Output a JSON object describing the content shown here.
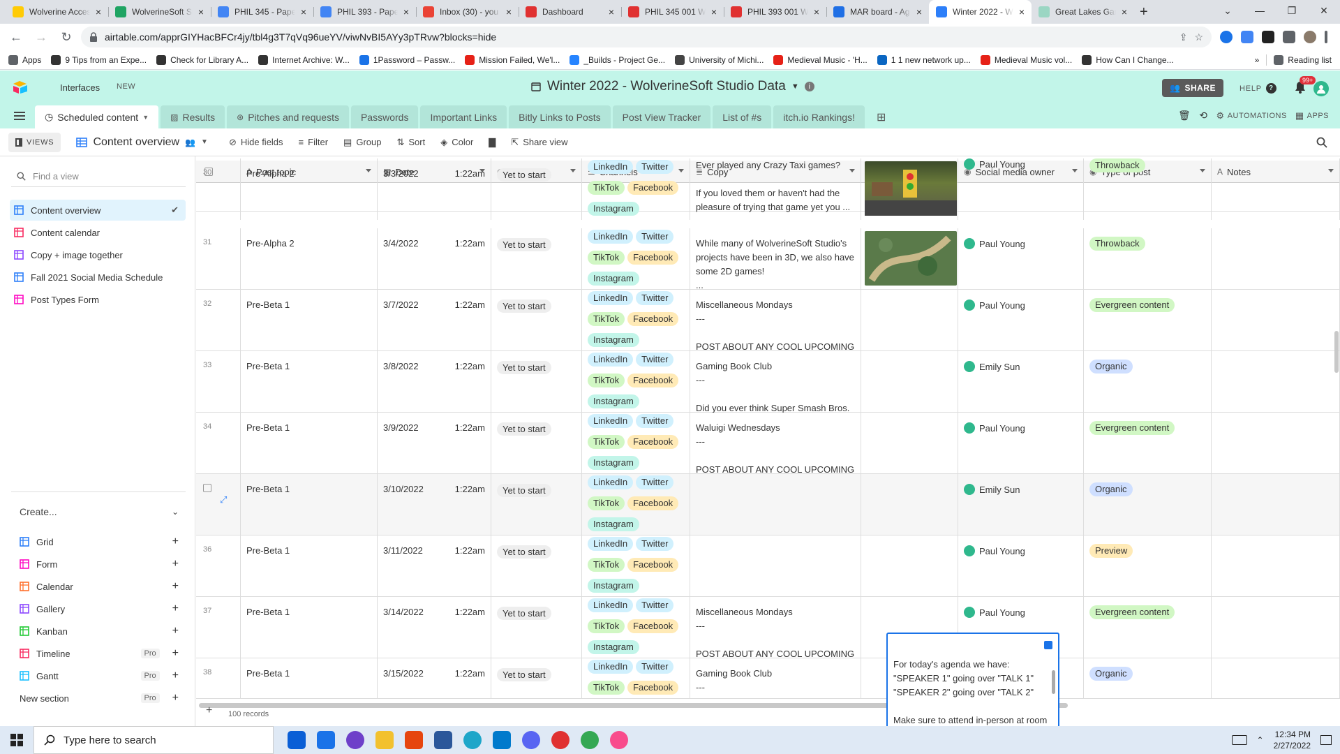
{
  "browser": {
    "tabs": [
      {
        "title": "Wolverine Accessibility",
        "color": "#ffcb05"
      },
      {
        "title": "WolverineSoft Studio",
        "color": "#1fa463"
      },
      {
        "title": "PHIL 345 - Paper",
        "color": "#4285f4"
      },
      {
        "title": "PHIL 393 - Paper",
        "color": "#4285f4"
      },
      {
        "title": "Inbox (30) - you",
        "color": "#ea4335"
      },
      {
        "title": "Dashboard",
        "color": "#e03131"
      },
      {
        "title": "PHIL 345 001 W",
        "color": "#e03131"
      },
      {
        "title": "PHIL 393 001 W",
        "color": "#e03131"
      },
      {
        "title": "MAR board - Ag",
        "color": "#1f6fe5"
      },
      {
        "title": "Winter 2022 - W",
        "color": "#2d7ff9"
      },
      {
        "title": "Great Lakes Gar",
        "color": "#9bd6c3"
      }
    ],
    "active_tab_index": 9,
    "new_tab": "+",
    "url": "airtable.com/apprGIYHacBFCr4jy/tbl4g3T7qVq96ueYV/viwNvBI5AYy3pTRvw?blocks=hide",
    "bookmarks": [
      {
        "label": "Apps",
        "color": "#5f6368"
      },
      {
        "label": "9 Tips from an Expe...",
        "color": "#333"
      },
      {
        "label": "Check for Library A...",
        "color": "#333"
      },
      {
        "label": "Internet Archive: W...",
        "color": "#333"
      },
      {
        "label": "1Password – Passw...",
        "color": "#1a73e8"
      },
      {
        "label": "Mission Failed, We'l...",
        "color": "#e62117"
      },
      {
        "label": "_Builds - Project Ge...",
        "color": "#2684ff"
      },
      {
        "label": "University of Michi...",
        "color": "#444"
      },
      {
        "label": "Medieval Music - 'H...",
        "color": "#e62117"
      },
      {
        "label": "1 1 new network up...",
        "color": "#0a66c2"
      },
      {
        "label": "Medieval Music vol...",
        "color": "#e62117"
      },
      {
        "label": "How Can I Change...",
        "color": "#333"
      }
    ],
    "bookmarks_more": "»",
    "reading_list": "Reading list"
  },
  "airtable": {
    "interfaces_label": "Interfaces",
    "new_badge": "NEW",
    "base_title": "Winter 2022 - WolverineSoft Studio Data",
    "share_label": "SHARE",
    "help_label": "HELP",
    "notif_count": "99+",
    "table_tabs": [
      "Scheduled content",
      "Results",
      "Pitches and requests",
      "Passwords",
      "Important Links",
      "Bitly Links to Posts",
      "Post View Tracker",
      "List of #s",
      "itch.io Rankings!"
    ],
    "automations_label": "AUTOMATIONS",
    "apps_label": "APPS",
    "views_label": "VIEWS",
    "current_view": "Content overview",
    "toolbar": {
      "hide_fields": "Hide fields",
      "filter": "Filter",
      "group": "Group",
      "sort": "Sort",
      "color": "Color",
      "share_view": "Share view"
    }
  },
  "sidebar": {
    "find_placeholder": "Find a view",
    "views": [
      {
        "label": "Content overview",
        "icon": "grid-icon",
        "color": "#2d7ff9"
      },
      {
        "label": "Content calendar",
        "icon": "calendar-icon",
        "color": "#f82b60"
      },
      {
        "label": "Copy + image together",
        "icon": "gallery-icon",
        "color": "#8b46ff"
      },
      {
        "label": "Fall 2021 Social Media Schedule",
        "icon": "grid-icon",
        "color": "#2d7ff9"
      },
      {
        "label": "Post Types Form",
        "icon": "form-icon",
        "color": "#ff08c2"
      }
    ],
    "create_label": "Create...",
    "create_items": [
      {
        "label": "Grid",
        "color": "#2d7ff9",
        "pro": ""
      },
      {
        "label": "Form",
        "color": "#ff08c2",
        "pro": ""
      },
      {
        "label": "Calendar",
        "color": "#ff6f2c",
        "pro": ""
      },
      {
        "label": "Gallery",
        "color": "#8b46ff",
        "pro": ""
      },
      {
        "label": "Kanban",
        "color": "#20c933",
        "pro": ""
      },
      {
        "label": "Timeline",
        "color": "#f82b60",
        "pro": "Pro"
      },
      {
        "label": "Gantt",
        "color": "#18bfff",
        "pro": "Pro"
      }
    ],
    "new_section": "New section",
    "new_section_pro": "Pro"
  },
  "grid": {
    "headers": [
      "Post topic",
      "Date",
      "Status",
      "Channels",
      "Copy",
      "Image",
      "Social media owner",
      "Type of post",
      "Notes"
    ],
    "rows": [
      {
        "num": "30",
        "topic": "Pre-Alpha 2",
        "date": "3/3/2022",
        "time": "1:22am",
        "status": "Yet to start",
        "channels": [
          "LinkedIn",
          "Twitter",
          "TikTok",
          "Facebook",
          "Instagram"
        ],
        "copy": "Ever played any Crazy Taxi games?\n\nIf you loved them or haven't had the pleasure of trying that game yet you ...",
        "image": "racing",
        "owner": "Paul Young",
        "type": "Throwback"
      },
      {
        "num": "31",
        "topic": "Pre-Alpha 2",
        "date": "3/4/2022",
        "time": "1:22am",
        "status": "Yet to start",
        "channels": [
          "LinkedIn",
          "Twitter",
          "TikTok",
          "Facebook",
          "Instagram"
        ],
        "copy": "While many of WolverineSoft Studio's projects have been in 3D, we also have some 2D games!\n...",
        "image": "map",
        "owner": "Paul Young",
        "type": "Throwback"
      },
      {
        "num": "32",
        "topic": "Pre-Beta 1",
        "date": "3/7/2022",
        "time": "1:22am",
        "status": "Yet to start",
        "channels": [
          "LinkedIn",
          "Twitter",
          "TikTok",
          "Facebook",
          "Instagram"
        ],
        "copy": "Miscellaneous Mondays\n---\n\nPOST ABOUT ANY COOL UPCOMING ...",
        "image": "",
        "owner": "Paul Young",
        "type": "Evergreen content"
      },
      {
        "num": "33",
        "topic": "Pre-Beta 1",
        "date": "3/8/2022",
        "time": "1:22am",
        "status": "Yet to start",
        "channels": [
          "LinkedIn",
          "Twitter",
          "TikTok",
          "Facebook",
          "Instagram"
        ],
        "copy": "Gaming Book Club\n---\n\nDid you ever think Super Smash Bros. ...",
        "image": "",
        "owner": "Emily Sun",
        "type": "Organic"
      },
      {
        "num": "34",
        "topic": "Pre-Beta 1",
        "date": "3/9/2022",
        "time": "1:22am",
        "status": "Yet to start",
        "channels": [
          "LinkedIn",
          "Twitter",
          "TikTok",
          "Facebook",
          "Instagram"
        ],
        "copy": "Waluigi Wednesdays\n---\n\nPOST ABOUT ANY COOL UPCOMING ...",
        "image": "",
        "owner": "Paul Young",
        "type": "Evergreen content"
      },
      {
        "num": "",
        "topic": "Pre-Beta 1",
        "date": "3/10/2022",
        "time": "1:22am",
        "status": "Yet to start",
        "channels": [
          "LinkedIn",
          "Twitter",
          "TikTok",
          "Facebook",
          "Instagram"
        ],
        "copy": "",
        "image": "",
        "owner": "Emily Sun",
        "type": "Organic"
      },
      {
        "num": "36",
        "topic": "Pre-Beta 1",
        "date": "3/11/2022",
        "time": "1:22am",
        "status": "Yet to start",
        "channels": [
          "LinkedIn",
          "Twitter",
          "TikTok",
          "Facebook",
          "Instagram"
        ],
        "copy": "",
        "image": "",
        "owner": "Paul Young",
        "type": "Preview"
      },
      {
        "num": "37",
        "topic": "Pre-Beta 1",
        "date": "3/14/2022",
        "time": "1:22am",
        "status": "Yet to start",
        "channels": [
          "LinkedIn",
          "Twitter",
          "TikTok",
          "Facebook",
          "Instagram"
        ],
        "copy": "Miscellaneous Mondays\n---\n\nPOST ABOUT ANY COOL UPCOMING ...",
        "image": "",
        "owner": "Paul Young",
        "type": "Evergreen content"
      },
      {
        "num": "38",
        "topic": "Pre-Beta 1",
        "date": "3/15/2022",
        "time": "1:22am",
        "status": "Yet to start",
        "channels": [
          "LinkedIn",
          "Twitter",
          "TikTok",
          "Facebook"
        ],
        "copy": "Gaming Book Club\n---",
        "image": "",
        "owner": "Emily Sun",
        "type": "Organic"
      }
    ],
    "editing_copy": "For today's agenda we have:\n\"SPEAKER 1\" going over \"TALK 1\"\n\"SPEAKER 2\" going over \"TALK 2\"\n\nMake sure to attend in-person at room BBB 1690 at North Campus or via Discord if these topics",
    "records_count": "100 records"
  },
  "taskbar": {
    "search_placeholder": "Type here to search",
    "time": "12:34 PM",
    "date": "2/27/2022"
  }
}
